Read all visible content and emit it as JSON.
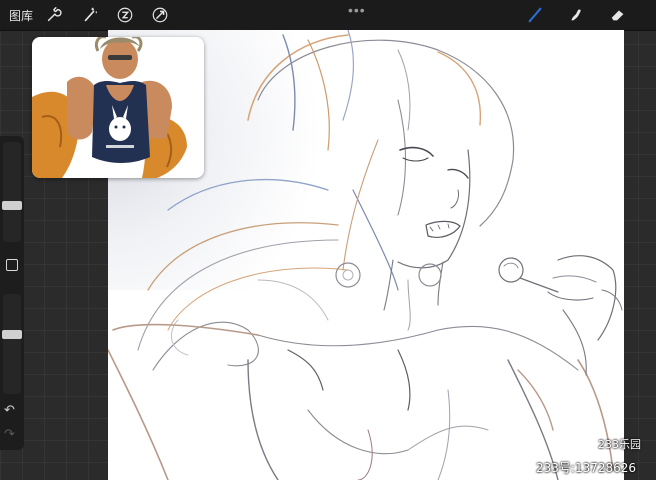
{
  "topbar": {
    "gallery_label": "图库",
    "more_label": "•••",
    "left_tools": [
      "wrench-icon",
      "magic-wand-icon",
      "selection-icon",
      "transform-icon"
    ],
    "right_tools": [
      "brush-icon",
      "smudge-icon",
      "eraser-icon"
    ],
    "active_color": "#2a6fdb"
  },
  "sidebar": {
    "brush_size_level": 0.35,
    "opacity_level": 0.6,
    "undo_label": "↶",
    "redo_label": "↷"
  },
  "watermark": {
    "line1": "233乐园",
    "line2": "233号:13728626"
  }
}
